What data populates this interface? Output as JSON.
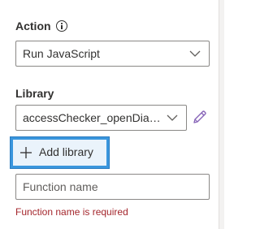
{
  "action": {
    "label": "Action",
    "info_icon": "info-circle-icon",
    "selected": "Run JavaScript",
    "chevron_icon": "chevron-down-icon"
  },
  "library": {
    "label": "Library",
    "selected": "accessChecker_openDialo...",
    "chevron_icon": "chevron-down-icon",
    "edit_icon": "pencil-icon"
  },
  "add_library": {
    "label": "Add library",
    "icon": "plus-icon"
  },
  "function_name": {
    "value": "",
    "placeholder": "Function name",
    "error": "Function name is required"
  },
  "colors": {
    "error": "#a4262c",
    "accent": "#8764b8",
    "focus": "#3a96dd",
    "border": "#8a8886"
  }
}
